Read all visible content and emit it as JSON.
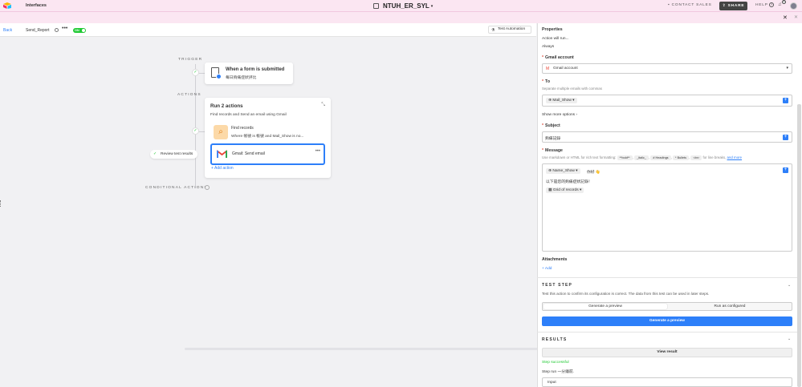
{
  "topbar": {
    "app_name": "Interfaces",
    "base_title": "NTUH_ER_SYL",
    "base_caret": "▾",
    "contact_sales": "CONTACT SALES",
    "share": "SHARE",
    "help": "HELP",
    "notification_count": "1"
  },
  "automation": {
    "back": "Back",
    "name": "Send_Report",
    "toggle": "ON",
    "test_button": "Test Automation"
  },
  "canvas": {
    "trigger_label": "TRIGGER",
    "trigger_title": "When a form is submitted",
    "trigger_sub": "每日夠痛症狀評比",
    "actions_label": "ACTIONS",
    "run_title": "Run 2 actions",
    "run_sub": "Find records and Send an email using Gmail",
    "find_title": "Find records",
    "find_sub": "Where 帳號 is 帳號 and Mail_Show is no...",
    "gmail_label": "Gmail: Send email",
    "add_action": "Add action",
    "review": "Review test results",
    "conditional_label": "CONDITIONAL ACTIONS"
  },
  "panel": {
    "properties": "Properties",
    "action_will_run": "Action will run...",
    "always": "Always",
    "gmail_account_label": "Gmail account",
    "gmail_account_value": "Gmail account",
    "to_label": "To",
    "to_hint": "Separate multiple emails with commas",
    "to_chip": "Mail_Show",
    "show_more": "Show more options",
    "subject_label": "Subject",
    "subject_value": "夠痛記錄",
    "message_label": "Message",
    "message_hint": "Use markdown or HTML for rich text formatting:",
    "md_bold": "**bold**",
    "md_italic": "_italic_",
    "md_headings": "# Headings",
    "md_bullets": "* Bullets",
    "md_br": "<br>",
    "md_br_note": "for line breaks,",
    "and_more": "and more",
    "msg_chip_name": "Name_Show",
    "msg_greeting": "你好 👋",
    "msg_line2": "以下是您的夠痛症狀記錄！",
    "msg_chip_grid": "Grid of records",
    "attachments_label": "Attachments",
    "add": "Add",
    "test_step_hd": "TEST STEP",
    "test_step_text": "Test this action to confirm its configuration is correct. The data from this test can be used in later steps.",
    "tab_preview": "Generate a preview",
    "tab_configured": "Run as configured",
    "generate_btn": "Generate a preview",
    "results_hd": "RESULTS",
    "view_result": "View result",
    "step_successful": "Step successful",
    "step_run": "Step run 一分鐘前.",
    "input_label": "Input"
  },
  "colors": {
    "accent": "#2d7ff9",
    "success": "#20c933",
    "topbar_bg": "#fbe6f2"
  }
}
